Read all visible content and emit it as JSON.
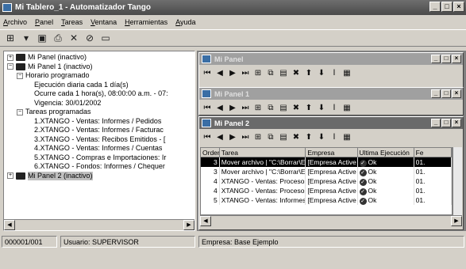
{
  "window": {
    "title": "Mi Tablero_1 - Automatizador Tango"
  },
  "menu": [
    "Archivo",
    "Panel",
    "Tareas",
    "Ventana",
    "Herramientas",
    "Ayuda"
  ],
  "tree": {
    "panel_inactive": "Mi Panel (inactivo)",
    "panel1": "Mi Panel 1 (inactivo)",
    "horario": "Horario programado",
    "ejecucion": "Ejecución diaria cada 1 día(s)",
    "ocurre": "Ocurre cada 1 hora(s), 08:00:00 a.m. - 07:",
    "vigencia": "Vigencia: 30/01/2002",
    "tareas": "Tareas programadas",
    "t1": "1.XTANGO - Ventas: Informes / Pedidos",
    "t2": "2.XTANGO - Ventas: Informes / Facturac",
    "t3": "3.XTANGO - Ventas: Recibos Emitidos - [",
    "t4": "4.XTANGO - Ventas: Informes / Cuentas",
    "t5": "5.XTANGO - Compras e Importaciones: Ir",
    "t6": "6.XTANGO - Fondos: Informes / Chequer",
    "panel2": "Mi Panel 2 (inactivo)"
  },
  "children": {
    "c1": "Mi Panel",
    "c2": "Mi Panel 1",
    "c3": "Mi Panel 2"
  },
  "grid": {
    "headers": [
      "Orden",
      "Tarea",
      "Empresa",
      "Ultima Ejecución",
      "Fe"
    ],
    "rows": [
      {
        "orden": "3",
        "tarea": "Mover archivo | \"C:\\Borrar\\E",
        "empresa": "[Empresa Active",
        "ult": "Ok",
        "fe": "01."
      },
      {
        "orden": "3",
        "tarea": "Mover archivo | \"C:\\Borrar\\E",
        "empresa": "[Empresa Active",
        "ult": "Ok",
        "fe": "01."
      },
      {
        "orden": "4",
        "tarea": "XTANGO - Ventas: Procesos",
        "empresa": "[Empresa Active",
        "ult": "Ok",
        "fe": "01."
      },
      {
        "orden": "4",
        "tarea": "XTANGO - Ventas: Procesos",
        "empresa": "[Empresa Active",
        "ult": "Ok",
        "fe": "01."
      },
      {
        "orden": "5",
        "tarea": "XTANGO - Ventas: Informes",
        "empresa": "[Empresa Active",
        "ult": "Ok",
        "fe": "01."
      }
    ]
  },
  "status": {
    "record": "000001/001",
    "user": "Usuario: SUPERVISOR",
    "company": "Empresa: Base Ejemplo"
  }
}
